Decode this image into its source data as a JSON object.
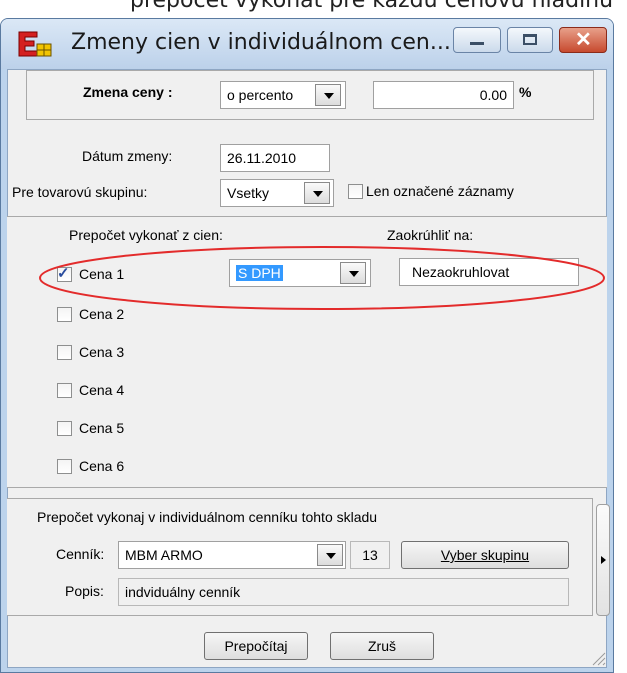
{
  "background_text": "prepočet vykonať pre každú cenovú hladinu",
  "window": {
    "title": "Zmeny cien  v individuálnom cen..."
  },
  "change": {
    "label": "Zmena ceny :",
    "mode": "o percento",
    "value": "0.00",
    "unit": "%"
  },
  "filters": {
    "date_label": "Dátum zmeny:",
    "date_value": "26.11.2010",
    "group_label": "Pre tovarovú skupinu:",
    "group_value": "Vsetky",
    "only_marked_label": "Len označené záznamy",
    "only_marked_checked": false
  },
  "prices": {
    "calc_from_label": "Prepočet vykonať z cien:",
    "round_label": "Zaokrúhliť na:",
    "vat_value": "S DPH",
    "round_value": "Nezaokruhlovat",
    "items": [
      {
        "label": "Cena 1",
        "checked": true
      },
      {
        "label": "Cena 2",
        "checked": false
      },
      {
        "label": "Cena 3",
        "checked": false
      },
      {
        "label": "Cena 4",
        "checked": false
      },
      {
        "label": "Cena 5",
        "checked": false
      },
      {
        "label": "Cena 6",
        "checked": false
      }
    ]
  },
  "pricelist": {
    "heading": "Prepočet vykonaj v individuálnom cenníku tohto skladu",
    "label": "Cenník:",
    "value": "MBM ARMO",
    "number": "13",
    "select_group_button": "Vyber skupinu",
    "description_label": "Popis:",
    "description_value": "indviduálny cenník"
  },
  "buttons": {
    "recalculate": "Prepočítaj",
    "cancel": "Zruš"
  },
  "colors": {
    "annotation": "#e32b2b",
    "selection": "#3399ff",
    "title_bg": "#bcd1ea"
  }
}
